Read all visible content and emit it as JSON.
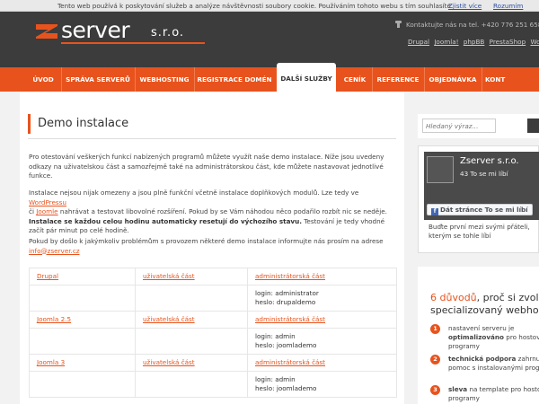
{
  "cookie_bar": {
    "text": "Tento web používá k poskytování služeb a analýze návštěvnosti soubory cookie. Používáním tohoto webu s tím souhlasíte.",
    "more_link": "Zjistit více",
    "ok_link": "Rozumím"
  },
  "header": {
    "logo_text": "server",
    "logo_suffix": "s.r.o.",
    "contact": "Kontaktujte nás na tel. +420 776 251 658",
    "quick_links": [
      "Drupal",
      "Joomla!",
      "phpBB",
      "PrestaShop",
      "WordPress"
    ]
  },
  "nav": {
    "items": [
      "ÚVOD",
      "SPRÁVA SERVERŮ",
      "WEBHOSTING",
      "REGISTRACE DOMÉN",
      "DALŠÍ SLUŽBY",
      "CENÍK",
      "REFERENCE",
      "OBJEDNÁVKA",
      "KONT"
    ],
    "active_index": 4
  },
  "main": {
    "title": "Demo instalace",
    "p1": "Pro otestování veškerých funkcí nabízených programů můžete využít naše demo instalace. Níže jsou uvedeny odkazy na uživatelskou část a samozřejmě také na administrátorskou část, kde můžete nastavovat jednotlivé funkce.",
    "p2_a": "Instalace nejsou nijak omezeny a jsou plně funkční včetně instalace doplňkových modulů. Lze tedy ve",
    "p2_link1": "WordPressu",
    "p2_b": "či",
    "p2_link2": "Joomle",
    "p2_c": "nahrávat a testovat libovolné rozšíření. Pokud by se Vám náhodou něco podařilo rozbít nic se neděje.",
    "p2_bold": "Instalace se každou celou hodinu automaticky resetují do výchozího stavu.",
    "p2_d": "Testování je tedy vhodné začít pár minut po celé hodině.",
    "p3": "Pokud by došlo k jakýmkoliv problémům s provozem některé demo instalace informujte nás prosím na adrese",
    "p3_email": "info@zserver.cz",
    "table": [
      {
        "name": "Drupal",
        "user": "uživatelská část",
        "admin": "administrátorská část",
        "login": "login: administrator",
        "password": "heslo: drupaldemo"
      },
      {
        "name": "Joomla 2.5",
        "user": "uživatelská část",
        "admin": "administrátorská část",
        "login": "login: admin",
        "password": "heslo: joomlademo"
      },
      {
        "name": "Joomla 3",
        "user": "uživatelská část",
        "admin": "administrátorská část",
        "login": "login: admin",
        "password": "heslo: joomlademo"
      }
    ]
  },
  "sidebar": {
    "search_placeholder": "Hledaný výraz...",
    "fb_name": "Zserver s.r.o.",
    "fb_likes": "43 To se mi líbí",
    "fb_like_button": "Dát stránce To se mi líbí",
    "fb_cta": "Buďte první mezi svými přáteli, kterým se tohle líbí",
    "why_num": "6 důvodů",
    "why_rest1": ", proč si zvolit",
    "why_line2": "specializovaný webhos",
    "reasons": [
      {
        "n": "1",
        "pre": "nastavení serveru je ",
        "bold": "optimalizováno",
        "post": " pro hostova programy"
      },
      {
        "n": "2",
        "pre": "",
        "bold": "technická podpora",
        "post": " zahrnuj pomoc s instalovanými progr"
      },
      {
        "n": "3",
        "pre": "",
        "bold": "sleva",
        "post": " na template pro hosto programy"
      }
    ]
  },
  "colors": {
    "accent": "#e8531d",
    "header_bg": "#3c3c3c"
  }
}
